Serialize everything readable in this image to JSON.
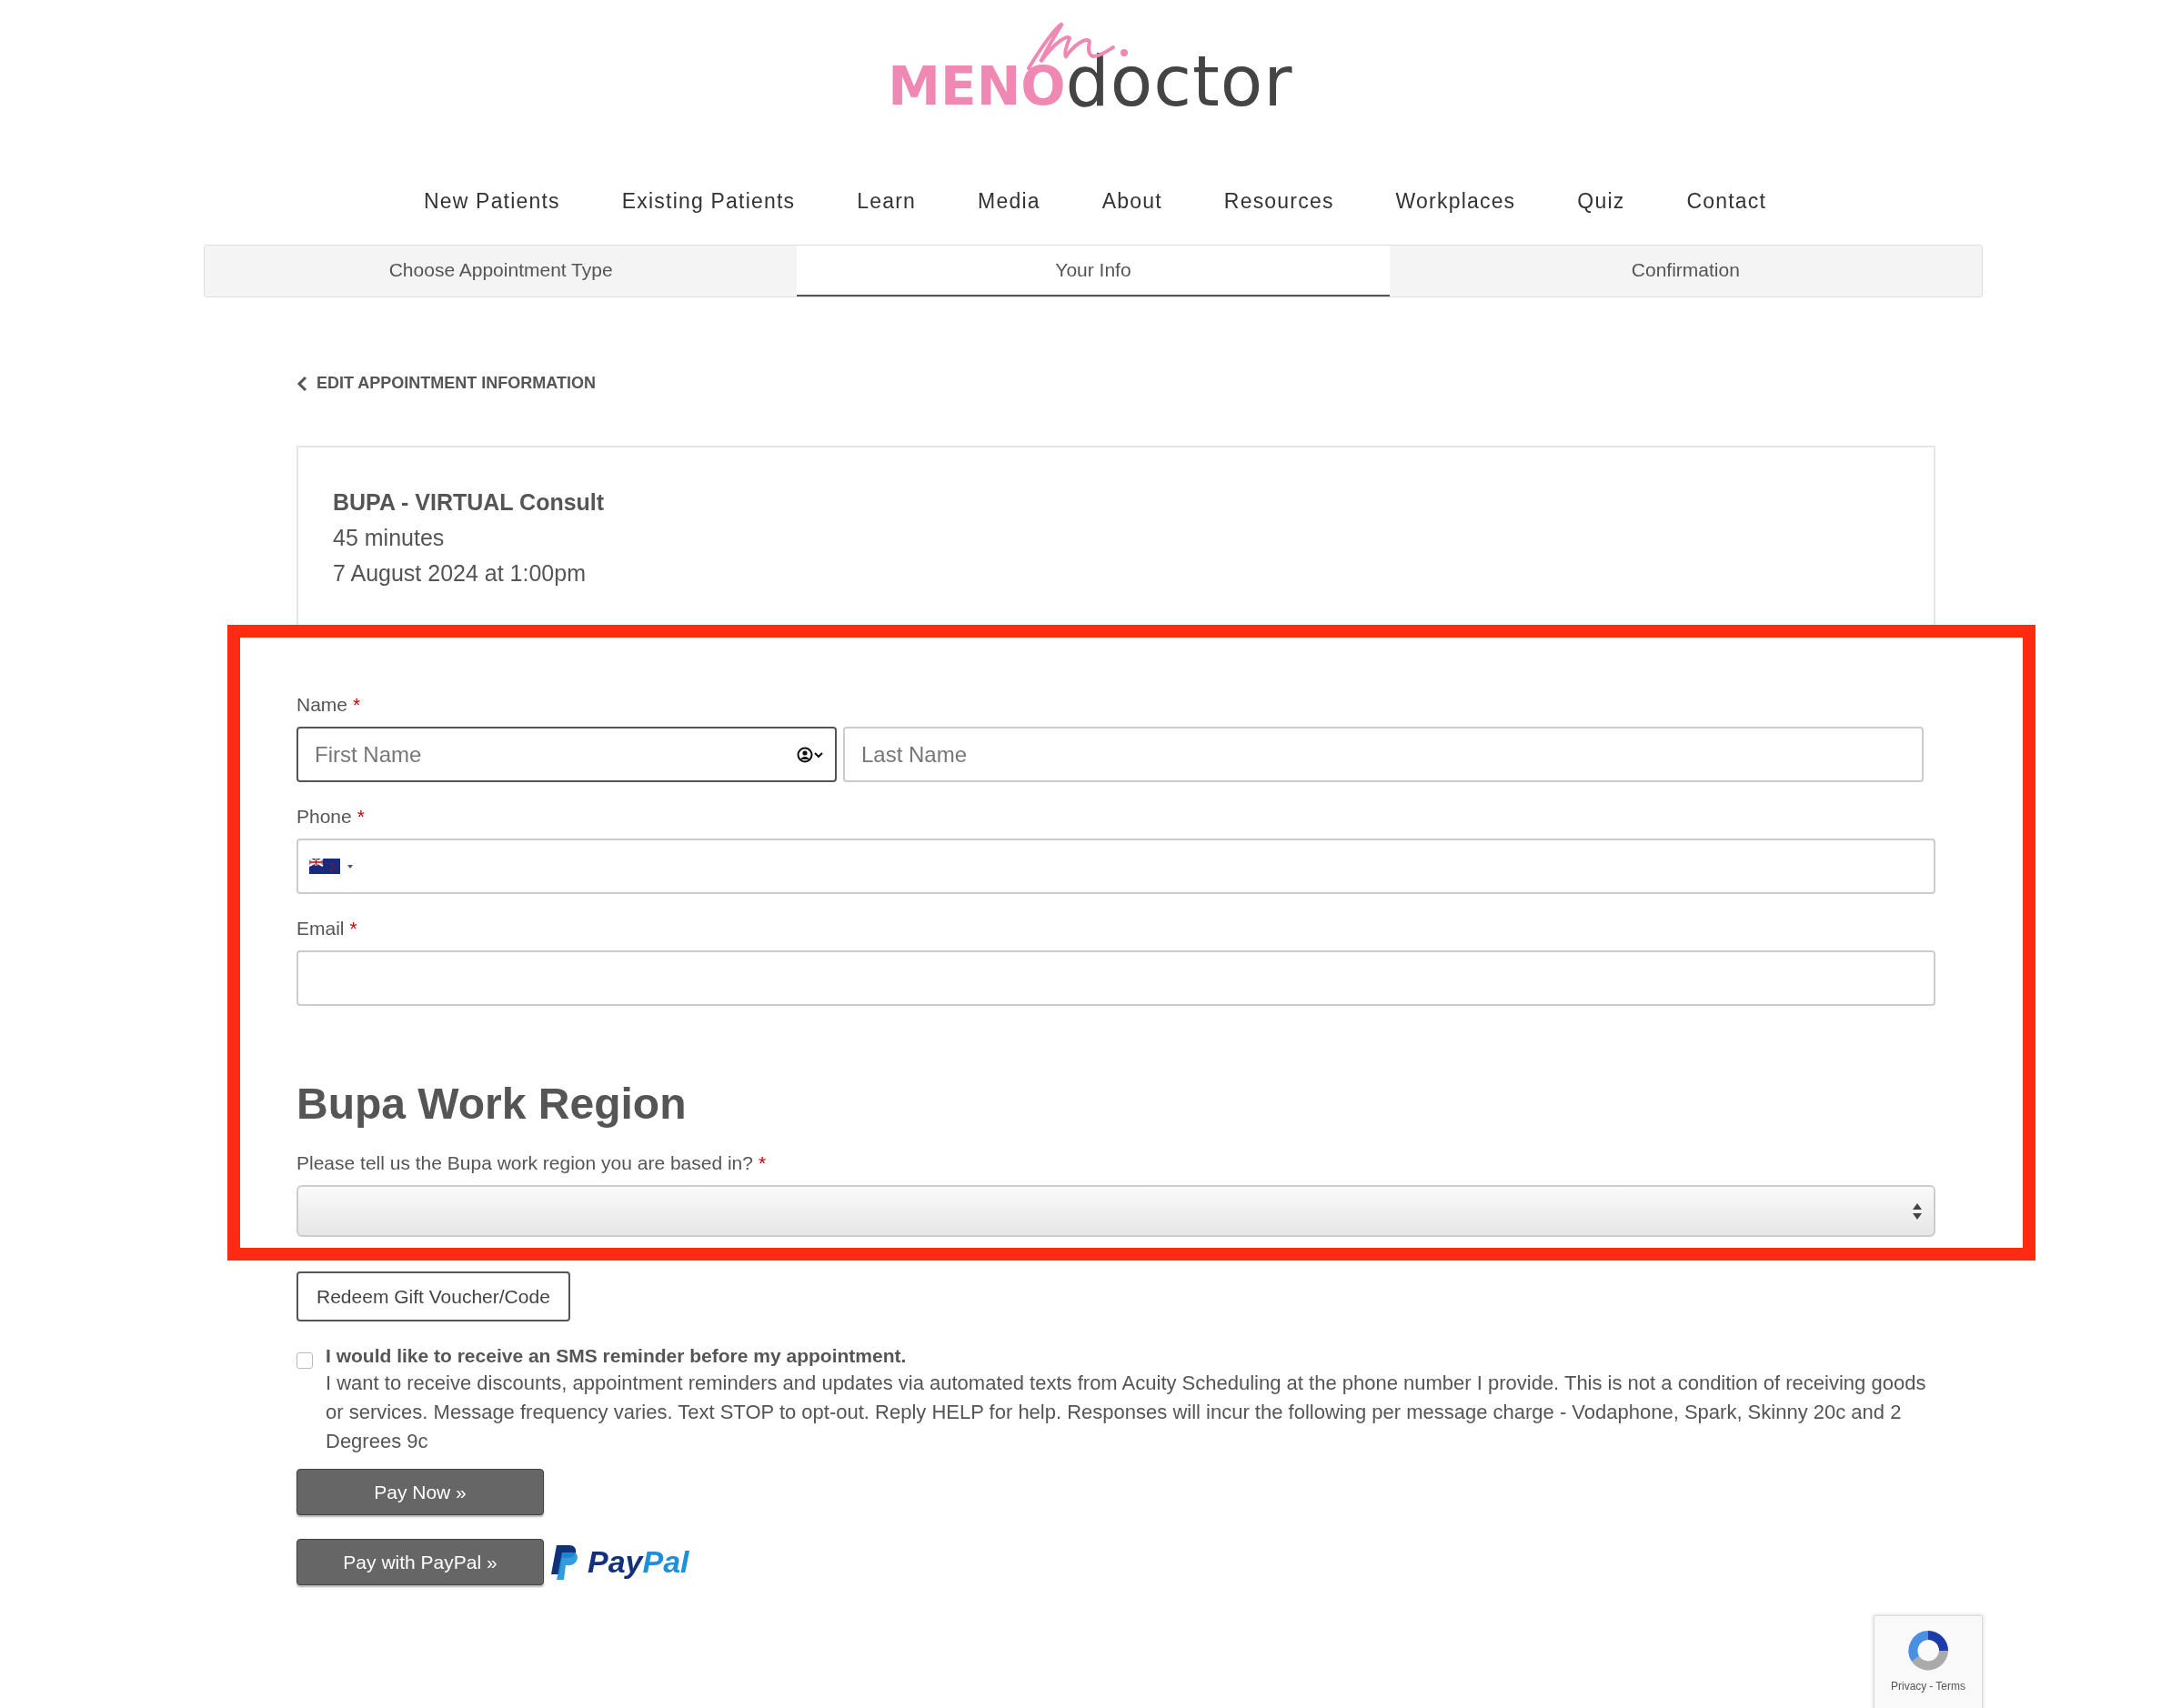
{
  "logo": {
    "brand_part_1": "MENO",
    "brand_part_2": "doctor"
  },
  "nav": [
    {
      "label": "New Patients"
    },
    {
      "label": "Existing Patients"
    },
    {
      "label": "Learn"
    },
    {
      "label": "Media"
    },
    {
      "label": "About"
    },
    {
      "label": "Resources"
    },
    {
      "label": "Workplaces"
    },
    {
      "label": "Quiz"
    },
    {
      "label": "Contact"
    }
  ],
  "steps": [
    {
      "label": "Choose Appointment Type",
      "selected": false
    },
    {
      "label": "Your Info",
      "selected": true
    },
    {
      "label": "Confirmation",
      "selected": false
    }
  ],
  "back_link": "EDIT APPOINTMENT INFORMATION",
  "appointment": {
    "title": "BUPA - VIRTUAL Consult",
    "duration": "45 minutes",
    "when": "7 August 2024 at 1:00pm"
  },
  "highlight_box": {
    "shown": true
  },
  "form": {
    "name_label": "Name",
    "required_mark": "*",
    "first_name": {
      "placeholder": "First Name",
      "focused": true
    },
    "last_name": {
      "placeholder": "Last Name"
    },
    "phone_label": "Phone",
    "email_label": "Email",
    "section_heading": "Bupa Work Region",
    "region_question": "Please tell us the Bupa work region you are based in?"
  },
  "redeem_button": "Redeem Gift Voucher/Code",
  "sms_opt_in": {
    "checked": false,
    "title": "I would like to receive an SMS reminder before my appointment.",
    "text": "I want to receive discounts, appointment reminders and updates via automated texts from Acuity Scheduling at the phone number I provide. This is not a condition of receiving goods or services. Message frequency varies. Text STOP to opt-out. Reply HELP for help. Responses will incur the following per message charge - Vodaphone, Spark, Skinny 20c and 2 Degrees 9c"
  },
  "pay_buttons": [
    "Pay Now »",
    "Pay with PayPal »"
  ],
  "paypal_logo": {
    "part_1": "Pay",
    "part_2": "Pal"
  },
  "recaptcha": {
    "privacy": "Privacy",
    "separator": "-",
    "terms": "Terms"
  }
}
